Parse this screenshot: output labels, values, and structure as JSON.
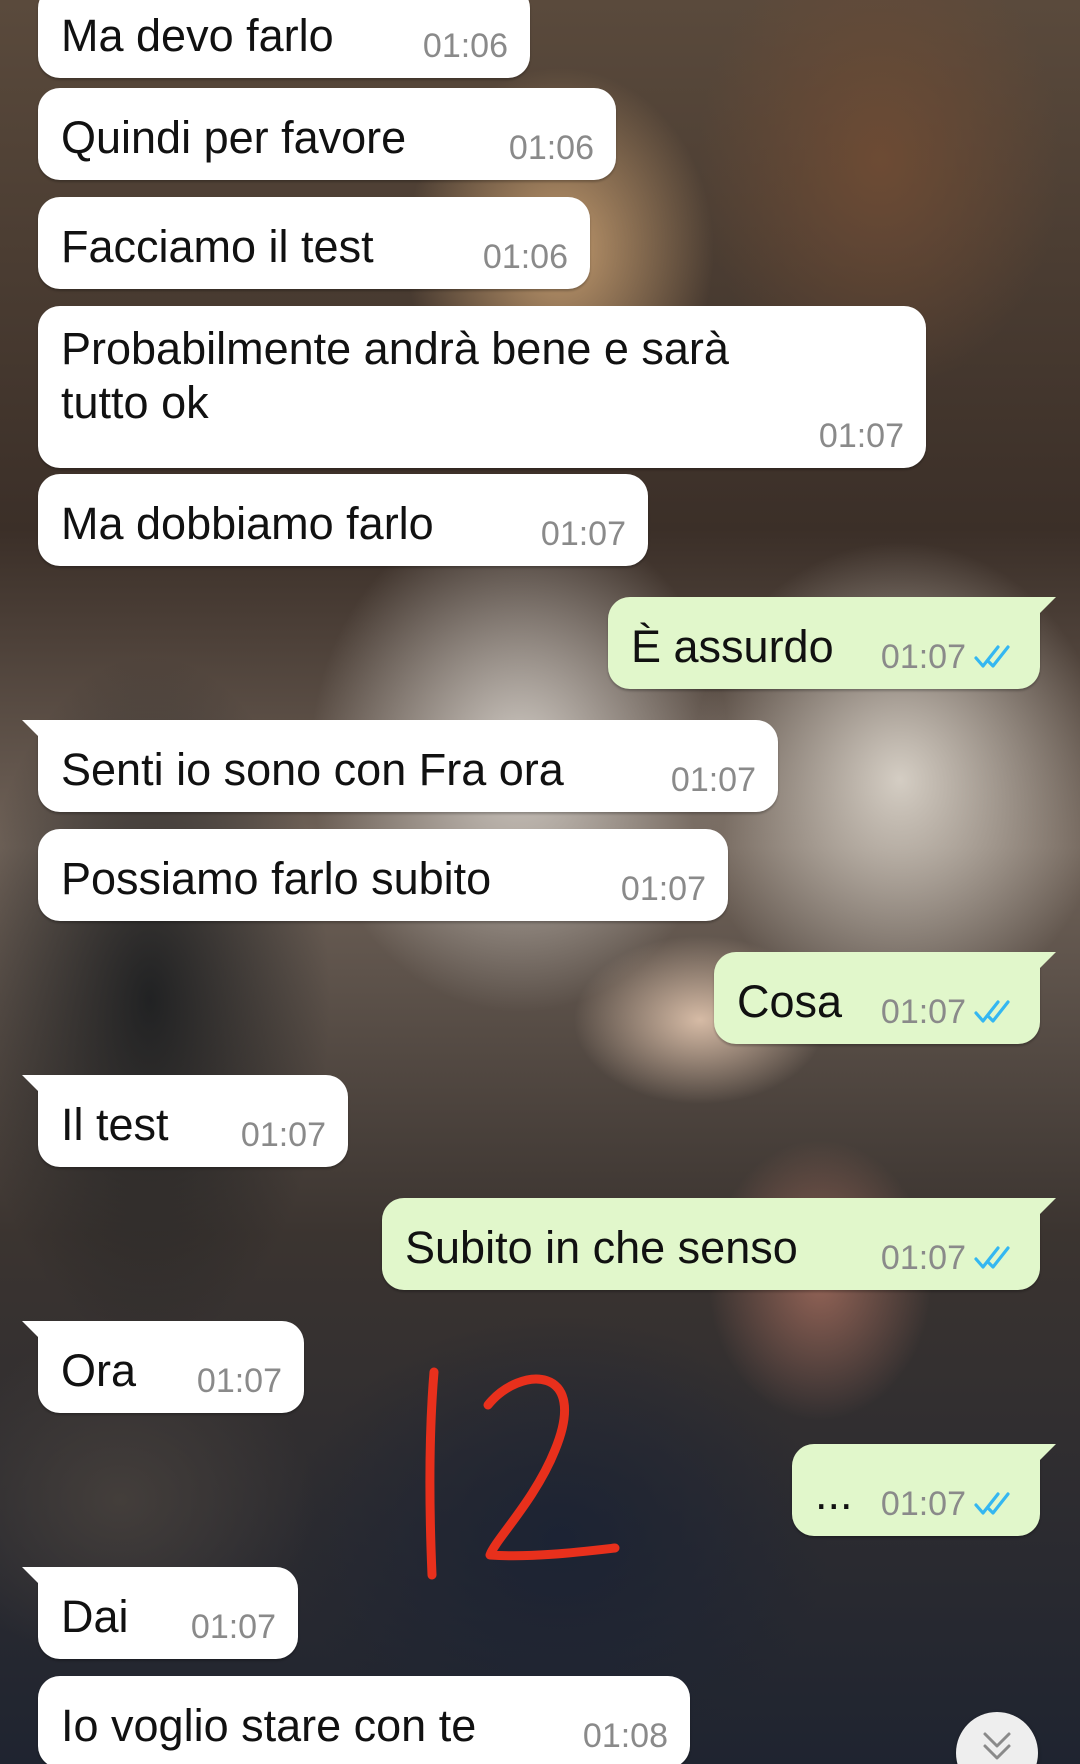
{
  "messages": [
    {
      "dir": "in",
      "text": "Ma devo farlo",
      "time": "01:06"
    },
    {
      "dir": "in",
      "text": "Quindi per favore",
      "time": "01:06"
    },
    {
      "dir": "in",
      "text": "Facciamo il test",
      "time": "01:06"
    },
    {
      "dir": "in",
      "text": "Probabilmente andrà bene e sarà\ntutto ok",
      "time": "01:07"
    },
    {
      "dir": "in",
      "text": "Ma dobbiamo farlo",
      "time": "01:07"
    },
    {
      "dir": "out",
      "text": "È assurdo",
      "time": "01:07",
      "status": "read"
    },
    {
      "dir": "in",
      "text": "Senti io sono con Fra ora",
      "time": "01:07"
    },
    {
      "dir": "in",
      "text": "Possiamo farlo subito",
      "time": "01:07"
    },
    {
      "dir": "out",
      "text": "Cosa",
      "time": "01:07",
      "status": "read"
    },
    {
      "dir": "in",
      "text": "Il test",
      "time": "01:07"
    },
    {
      "dir": "out",
      "text": "Subito in che senso",
      "time": "01:07",
      "status": "read"
    },
    {
      "dir": "in",
      "text": "Ora",
      "time": "01:07"
    },
    {
      "dir": "out",
      "text": "...",
      "time": "01:07",
      "status": "read"
    },
    {
      "dir": "in",
      "text": "Dai",
      "time": "01:07"
    },
    {
      "dir": "in",
      "text": "Io voglio stare con te",
      "time": "01:08"
    }
  ],
  "annotation": {
    "text": "12",
    "color": "#e8301c"
  },
  "colors": {
    "incoming_bubble": "#ffffff",
    "outgoing_bubble": "#e1f7cb",
    "read_ticks": "#34b7f1",
    "timestamp": "#8a8a8a"
  },
  "icons": {
    "read_receipt": "double-check-icon",
    "scroll_down": "chevron-double-down-icon"
  }
}
